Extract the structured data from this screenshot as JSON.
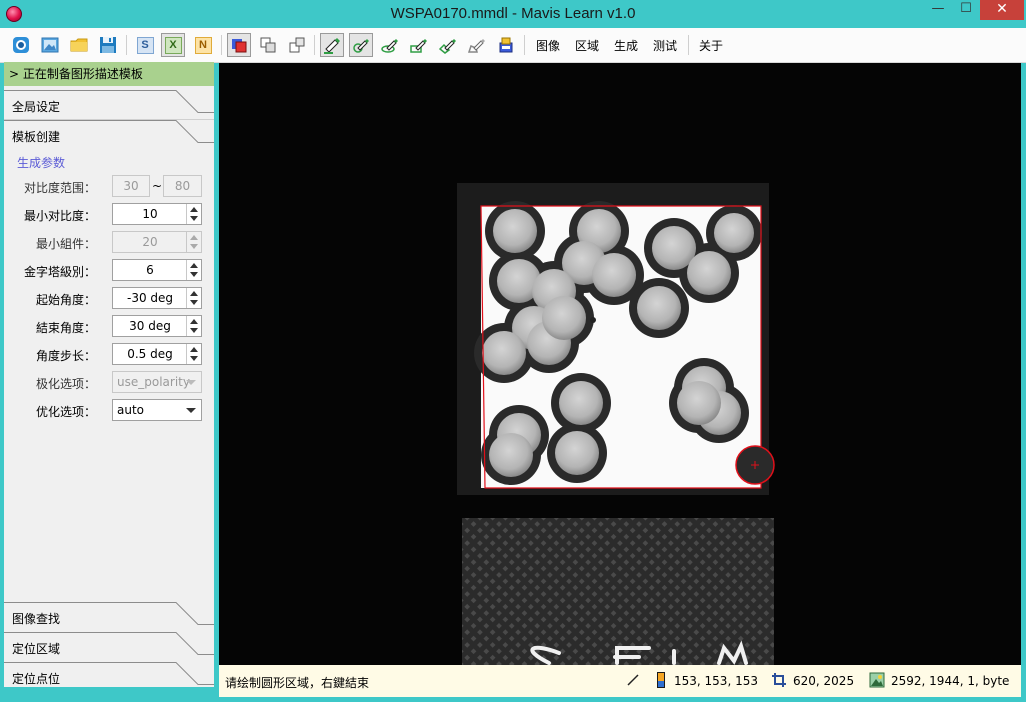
{
  "window": {
    "title": "WSPA0170.mmdl - Mavis Learn v1.0",
    "minimize_glyph": "—",
    "maximize_glyph": "☐",
    "close_glyph": "✕"
  },
  "toolbar": {
    "buttons": [
      {
        "icon": "camera-icon"
      },
      {
        "icon": "image-open-icon"
      },
      {
        "icon": "folder-icon"
      },
      {
        "icon": "save-icon"
      },
      {
        "icon": "s-letter-icon",
        "letter": "S"
      },
      {
        "icon": "x-letter-icon",
        "letter": "X"
      },
      {
        "icon": "n-letter-icon",
        "letter": "N"
      },
      {
        "icon": "region-color-icon"
      },
      {
        "icon": "region-copy-icon"
      },
      {
        "icon": "region-split-icon"
      },
      {
        "icon": "draw-line-icon"
      },
      {
        "icon": "draw-circle-icon"
      },
      {
        "icon": "draw-ellipse-icon"
      },
      {
        "icon": "draw-rectangle-icon"
      },
      {
        "icon": "draw-rotated-rect-icon"
      },
      {
        "icon": "draw-polygon-icon"
      },
      {
        "icon": "eraser-icon"
      }
    ],
    "menus": [
      "图像",
      "区域",
      "生成",
      "测试",
      "关于"
    ]
  },
  "left_panel": {
    "status_header": "> 正在制备图形描述模板",
    "sections_top": [
      "全局设定",
      "模板创建"
    ],
    "group_title": "生成参数",
    "params": {
      "contrast_range": {
        "label": "对比度范围：",
        "min": "30",
        "max": "80",
        "separator": "~"
      },
      "min_contrast": {
        "label": "最小对比度：",
        "value": "10"
      },
      "min_component": {
        "label": "最小組件：",
        "value": "20"
      },
      "pyramid_levels": {
        "label": "金字塔級別：",
        "value": "6"
      },
      "start_angle": {
        "label": "起始角度：",
        "value": "-30 deg"
      },
      "end_angle": {
        "label": "結束角度：",
        "value": "30 deg"
      },
      "angle_step": {
        "label": "角度步长：",
        "value": "0.5 deg"
      },
      "polarity": {
        "label": "极化选项：",
        "value": "use_polarity"
      },
      "optimization": {
        "label": "优化选项：",
        "value": "auto"
      }
    },
    "sections_bottom": [
      "图像查找",
      "定位区域",
      "定位点位"
    ]
  },
  "statusbar": {
    "message": "请绘制圆形区域，右鍵結束",
    "pixel_value": "153, 153, 153",
    "coordinates": "620, 2025",
    "image_info": "2592, 1944, 1, byte"
  },
  "colors": {
    "titlebar": "#3ec8c8",
    "status_header": "#a9d18e",
    "group_title": "#5b5bd6",
    "roi_red": "#e0101a",
    "statusbar_bg": "#fffbe6"
  }
}
